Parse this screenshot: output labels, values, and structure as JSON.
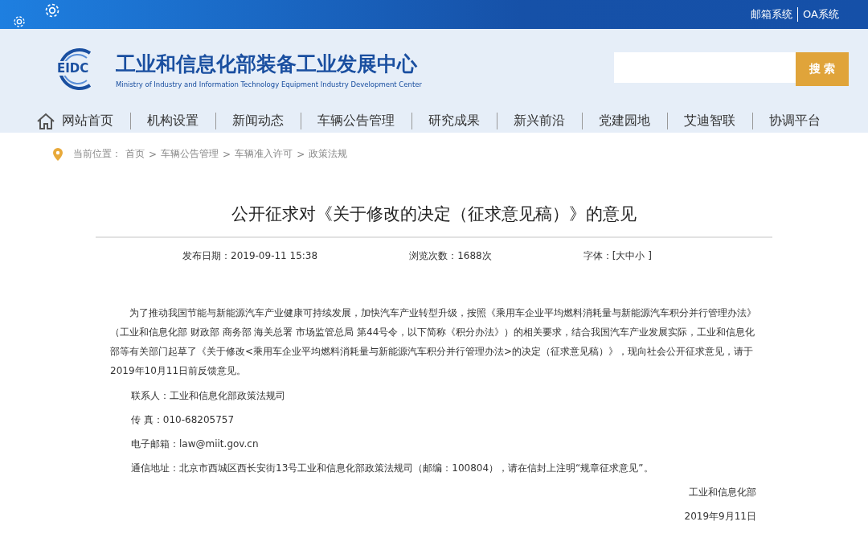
{
  "top_links": [
    "邮箱系统",
    "OA系统"
  ],
  "site": {
    "logo_text": "EIDC",
    "title": "工业和信息化部装备工业发展中心",
    "subtitle": "Ministry of Industry and Information Technology Equipment Industry Development Center"
  },
  "search": {
    "button": "搜 索"
  },
  "nav": [
    "网站首页",
    "机构设置",
    "新闻动态",
    "车辆公告管理",
    "研究成果",
    "新兴前沿",
    "党建园地",
    "艾迪智联",
    "协调平台"
  ],
  "breadcrumb": {
    "label": "当前位置：",
    "separator": ">",
    "items": [
      "首页",
      "车辆公告管理",
      "车辆准入许可",
      "政策法规"
    ]
  },
  "article": {
    "title": "公开征求对《关于修改的决定（征求意见稿）》的意见",
    "meta": [
      "发布日期：2019-09-11 15:38",
      "浏览次数：1688次",
      "字体：[大中小 ]"
    ],
    "body": "为了推动我国节能与新能源汽车产业健康可持续发展，加快汽车产业转型升级，按照《乘用车企业平均燃料消耗量与新能源汽车积分并行管理办法》（工业和信息化部 财政部 商务部 海关总署 市场监管总局 第44号令，以下简称《积分办法》）的相关要求，结合我国汽车产业发展实际，工业和信息化部等有关部门起草了《关于修改<乘用车企业平均燃料消耗量与新能源汽车积分并行管理办法>的决定（征求意见稿）》，现向社会公开征求意见，请于2019年10月11日前反馈意见。",
    "contacts": [
      "联系人：工业和信息化部政策法规司",
      "传  真：010-68205757",
      "电子邮箱：law@miit.gov.cn",
      "通信地址：北京市西城区西长安街13号工业和信息化部政策法规司（邮编：100804），请在信封上注明“规章征求意见”。"
    ],
    "signature": [
      "工业和信息化部",
      "2019年9月11日"
    ]
  }
}
